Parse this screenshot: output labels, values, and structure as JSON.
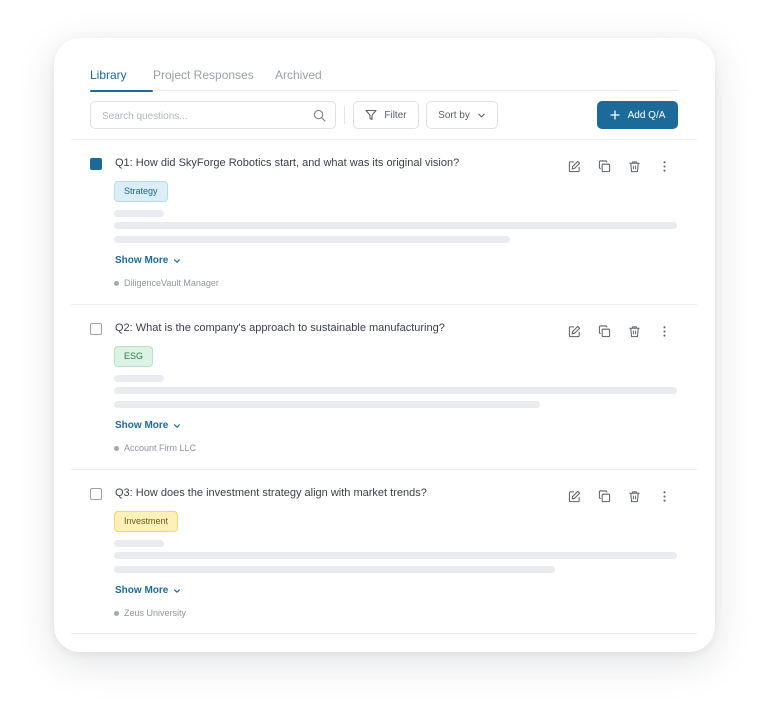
{
  "tabs": [
    {
      "label": "Library",
      "active": true
    },
    {
      "label": "Project Responses",
      "active": false
    },
    {
      "label": "Archived",
      "active": false
    }
  ],
  "toolbar": {
    "search_placeholder": "Search questions...",
    "filter_label": "Filter",
    "sort_label": "Sort by",
    "add_label": "Add Q/A"
  },
  "questions": [
    {
      "text": "Q1: How did SkyForge Robotics start, and what was its original vision?",
      "checked": true,
      "tag": "Strategy",
      "tag_color": "blue",
      "show_more": "Show More",
      "source": "DiligenceVault Manager"
    },
    {
      "text": "Q2: What is the company's approach to sustainable manufacturing?",
      "checked": false,
      "tag": "ESG",
      "tag_color": "green",
      "show_more": "Show More",
      "source": "Account Firm LLC"
    },
    {
      "text": "Q3: How does the investment strategy align with market trends?",
      "checked": false,
      "tag": "Investment",
      "tag_color": "yellow",
      "show_more": "Show More",
      "source": "Zeus University"
    }
  ],
  "colors": {
    "accent": "#1b6a9a",
    "tag_blue": "#dbeef8",
    "tag_green": "#dcf3e3",
    "tag_yellow": "#fdf0b8"
  },
  "icons": {
    "search": "search-icon",
    "filter": "filter-icon",
    "sort": "chevron-down-icon",
    "add": "plus-icon",
    "edit": "edit-icon",
    "copy": "copy-icon",
    "delete": "trash-icon",
    "more": "more-vertical-icon"
  }
}
